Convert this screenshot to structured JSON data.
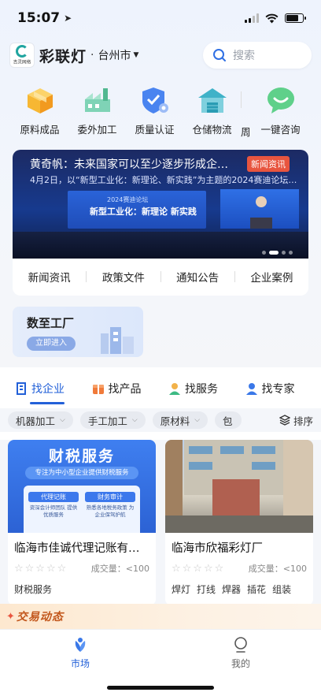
{
  "status": {
    "time": "15:07"
  },
  "header": {
    "logo_text": "吉灵网络",
    "app_name": "彩联灯",
    "city": "台州市",
    "search_placeholder": "搜索"
  },
  "categories": [
    {
      "label": "原料成品",
      "icon": "box-icon"
    },
    {
      "label": "委外加工",
      "icon": "factory-icon"
    },
    {
      "label": "质量认证",
      "icon": "shield-gear-icon"
    },
    {
      "label": "仓储物流",
      "icon": "warehouse-icon"
    },
    {
      "label": "一键咨询",
      "icon": "chat-icon"
    }
  ],
  "news": {
    "headline": "黄奇帆：未来国家可以至少逐步形成企…",
    "tag": "新闻资讯",
    "subline": "4月2日，以“新型工业化：新理论、新实践”为主题的2024赛迪论坛…",
    "screen_line1": "2024赛迪论坛",
    "screen_line2": "新型工业化：新理论 新实践",
    "tabs": [
      "新闻资讯",
      "政策文件",
      "通知公告",
      "企业案例"
    ]
  },
  "factory": {
    "title": "数至工厂",
    "button": "立即进入"
  },
  "find_tabs": [
    {
      "label": "找企业",
      "icon": "building-icon",
      "active": true
    },
    {
      "label": "找产品",
      "icon": "gift-box-icon",
      "active": false
    },
    {
      "label": "找服务",
      "icon": "service-person-icon",
      "active": false
    },
    {
      "label": "找专家",
      "icon": "person-icon",
      "active": false
    }
  ],
  "filters": {
    "chips": [
      "机器加工",
      "手工加工",
      "原材料",
      "包"
    ],
    "sort": "排序"
  },
  "cards": [
    {
      "title": "临海市佳诚代理记账有…",
      "volume_label": "成交量：<100",
      "tags": [
        "财税服务"
      ],
      "image": {
        "title": "财税服务",
        "subtitle": "专注为中小型企业提供财税服务",
        "box1_title": "代理记账",
        "box1_text": "资深会计师团队 提供优质服务",
        "box2_title": "财务审计",
        "box2_text": "熟悉各地税务政策 为企业保驾护航"
      }
    },
    {
      "title": "临海市欣福彩灯厂",
      "volume_label": "成交量：<100",
      "tags": [
        "焊灯",
        "打线",
        "焊器",
        "插花",
        "组装"
      ]
    }
  ],
  "trade_banner": "交易动态",
  "tabbar": [
    {
      "label": "市场",
      "active": true,
      "icon": "market-icon"
    },
    {
      "label": "我的",
      "active": false,
      "icon": "profile-icon"
    }
  ],
  "colors": {
    "accent": "#2260d8",
    "tag": "#e8553f",
    "trade": "#c2561b"
  }
}
